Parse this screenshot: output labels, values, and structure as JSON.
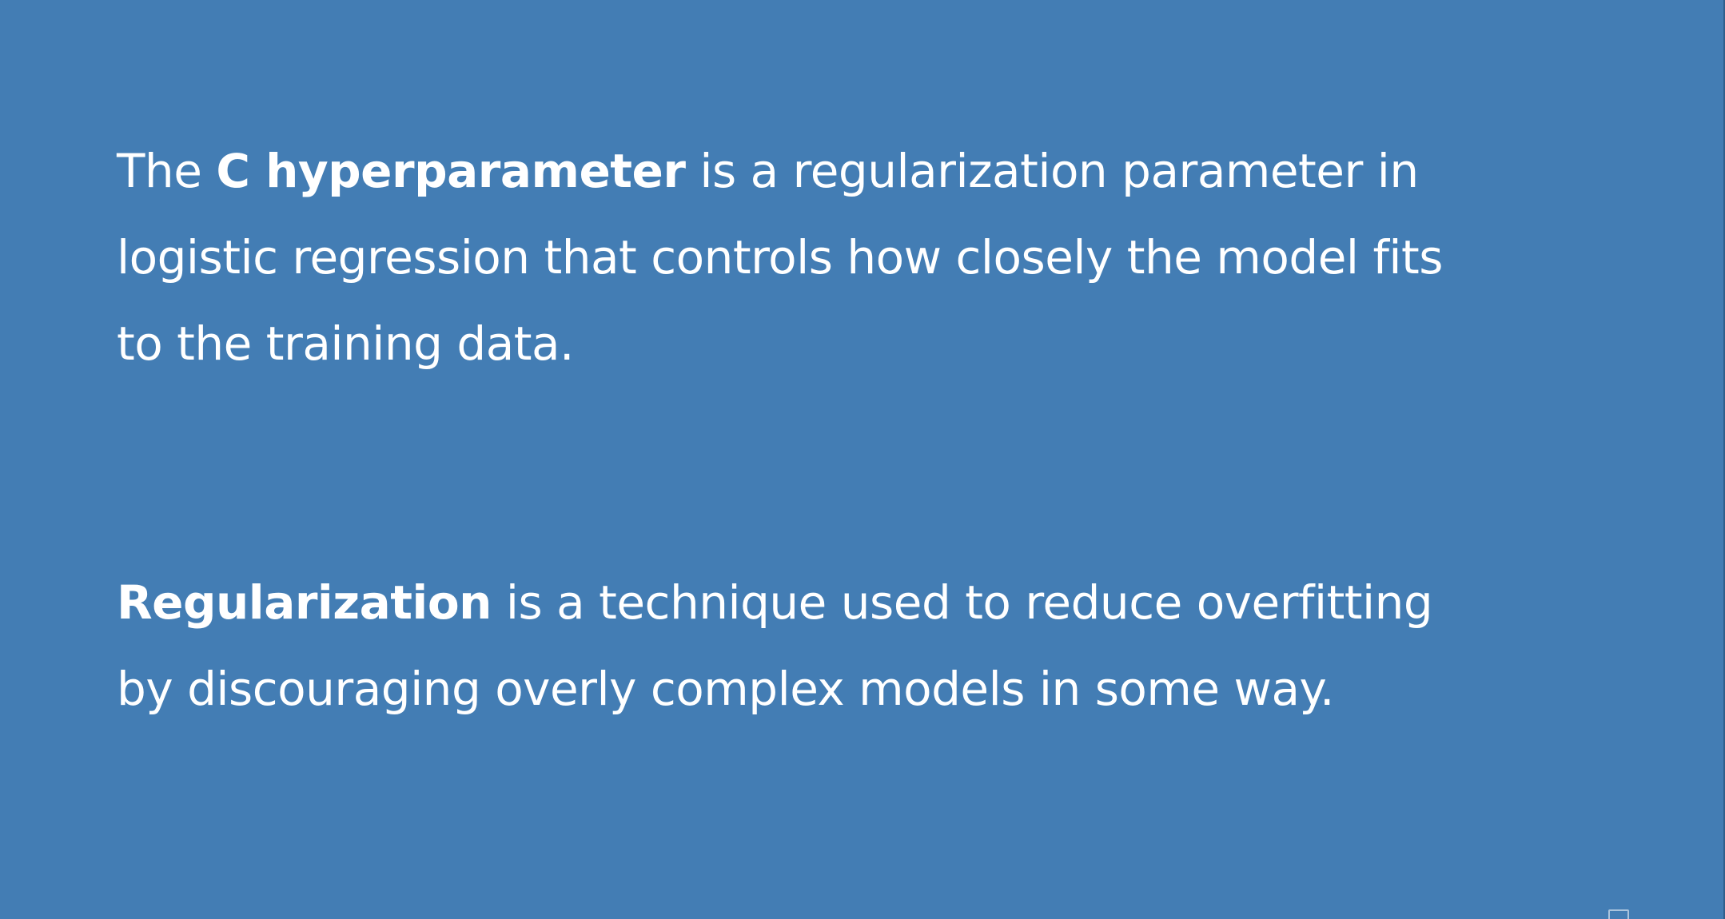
{
  "slide": {
    "background_color": "#437db4",
    "text_color": "#ffffff",
    "paragraph1": {
      "line1_pre": "The ",
      "line1_bold": "C hyperparameter",
      "line1_post": " is a regularization parameter in",
      "line2": "logistic regression that controls how closely the model fits",
      "line3": "to the training data."
    },
    "paragraph2": {
      "line1_bold": "Regularization",
      "line1_post": " is a technique used to reduce overfitting",
      "line2": "by discouraging overly complex models in some way."
    }
  }
}
